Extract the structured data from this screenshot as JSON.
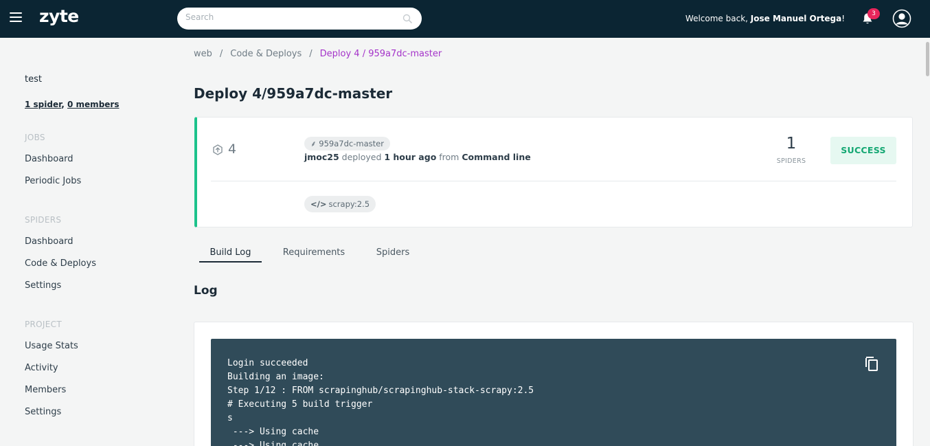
{
  "header": {
    "logo": "zyte",
    "search_placeholder": "Search",
    "welcome_prefix": "Welcome back, ",
    "user_name": "Jose Manuel Ortega",
    "welcome_suffix": "!",
    "notification_count": "3"
  },
  "sidebar": {
    "project_name": "test",
    "spiders_link": "1 spider",
    "members_link": "0 members",
    "sections": [
      {
        "title": "JOBS",
        "items": [
          "Dashboard",
          "Periodic Jobs"
        ]
      },
      {
        "title": "SPIDERS",
        "items": [
          "Dashboard",
          "Code & Deploys",
          "Settings"
        ]
      },
      {
        "title": "PROJECT",
        "items": [
          "Usage Stats",
          "Activity",
          "Members",
          "Settings"
        ]
      }
    ]
  },
  "breadcrumb": [
    "web",
    "Code & Deploys",
    "Deploy 4 / 959a7dc-master"
  ],
  "page_title": "Deploy 4/959a7dc-master",
  "deploy": {
    "number": "4",
    "branch": "959a7dc-master",
    "user": "jmoc25",
    "deployed_text": " deployed ",
    "time": "1 hour ago",
    "from_text": " from ",
    "source": "Command line",
    "spider_count": "1",
    "spider_label": "SPIDERS",
    "status": "SUCCESS",
    "stack_code": "</>",
    "stack": "scrapy:2.5"
  },
  "tabs": [
    "Build Log",
    "Requirements",
    "Spiders"
  ],
  "log": {
    "title": "Log",
    "lines": [
      "Login succeeded",
      "Building an image:",
      "Step 1/12 : FROM scrapinghub/scrapinghub-stack-scrapy:2.5",
      "# Executing 5 build trigger",
      "s",
      " ---> Using cache",
      " ---> Using cache"
    ]
  },
  "colors": {
    "topbar": "#0b2533",
    "accent_purple": "#a433c9",
    "success_green": "#1cc28b",
    "badge_red": "#e8255b",
    "log_background": "#304b59"
  }
}
